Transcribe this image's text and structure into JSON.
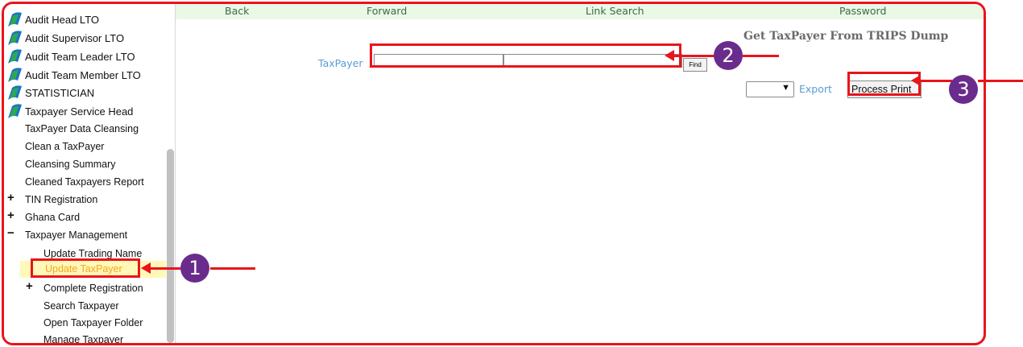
{
  "sidebar": {
    "roles": [
      "Audit Head LTO",
      "Audit Supervisor LTO",
      "Audit Team Leader LTO",
      "Audit Team Member LTO",
      "STATISTICIAN",
      "Taxpayer Service Head"
    ],
    "items": {
      "data_cleansing": "TaxPayer Data Cleansing",
      "clean_taxpayer": "Clean a TaxPayer",
      "cleansing_summary": "Cleansing Summary",
      "cleaned_report": "Cleaned Taxpayers Report",
      "tin_registration": "TIN Registration",
      "ghana_card": "Ghana Card",
      "taxpayer_management": "Taxpayer Management",
      "update_trading_name": "Update Trading Name",
      "update_taxpayer": "Update TaxPayer",
      "complete_registration": "Complete Registration",
      "search_taxpayer": "Search Taxpayer",
      "open_folder": "Open Taxpayer Folder",
      "manage_taxpayer": "Manage Taxpayer"
    },
    "expand_symbol": "+",
    "collapse_symbol": "−"
  },
  "topnav": {
    "back": "Back",
    "forward": "Forward",
    "link_search": "Link Search",
    "password": "Password"
  },
  "main": {
    "title": "Get TaxPayer From TRIPS Dump",
    "taxpayer_label": "TaxPayer",
    "find_button": "Find",
    "export_label": "Export",
    "process_button": "Process Print"
  },
  "annotations": {
    "badge1": "1",
    "badge2": "2",
    "badge3": "3"
  },
  "colors": {
    "highlight": "#e8151b",
    "badge": "#6a2c8c",
    "link": "#5b9bd5",
    "nav_bg": "#eaf8e6"
  }
}
